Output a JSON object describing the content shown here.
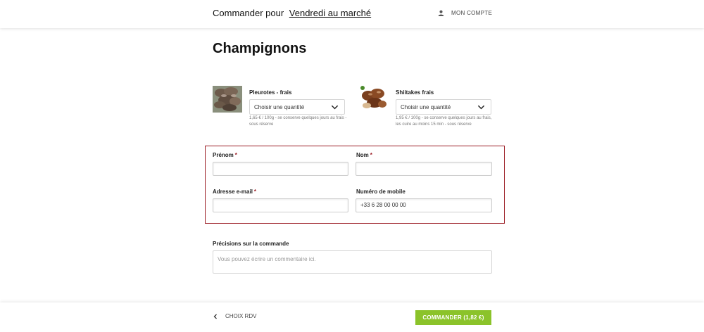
{
  "header": {
    "title_prefix": "Commander pour",
    "title_link": "Vendredi au marché",
    "account_label": "MON COMPTE",
    "account_icon": "user-icon"
  },
  "page": {
    "title": "Champignons"
  },
  "products": [
    {
      "name": "Pleurotes - frais",
      "select_label": "Choisir une quantité",
      "note": "1,65 € / 100g - se conserve quelques jours au frais - sous réserve"
    },
    {
      "name": "Shiitakes frais",
      "select_label": "Choisir une quantité",
      "note": "1,95 € / 100g - se conserve quelques jours au frais, les cuire au moins 15 min - sous réserve"
    }
  ],
  "form": {
    "first_name_label": "Prénom",
    "last_name_label": "Nom",
    "email_label": "Adresse e-mail",
    "mobile_label": "Numéro de mobile",
    "mobile_value": "+33 6 28 00 00 00",
    "required_marker": "*",
    "comment_label": "Précisions sur la commande",
    "comment_placeholder": "Vous pouvez écrire un commentaire ici."
  },
  "footer": {
    "back_label": "CHOIX RDV",
    "order_label": "COMMANDER (1,82 €)"
  },
  "colors": {
    "accent_red": "#9b1c24",
    "order_green": "#8bc32a"
  }
}
